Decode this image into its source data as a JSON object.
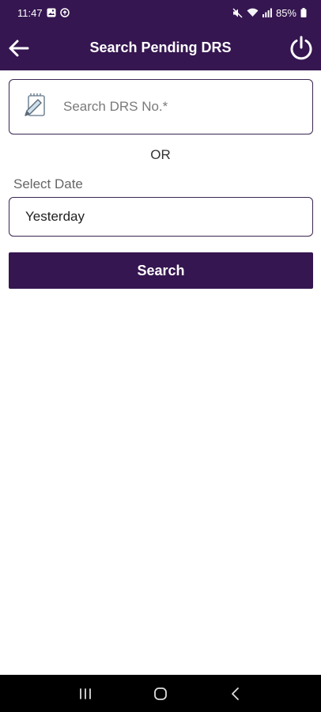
{
  "status_bar": {
    "time": "11:47",
    "battery": "85%"
  },
  "app_bar": {
    "title": "Search Pending DRS",
    "back_icon": "arrow-left-icon",
    "power_icon": "power-icon"
  },
  "search": {
    "placeholder": "Search DRS No.*",
    "value": "",
    "icon": "notepad-pencil-icon"
  },
  "or_label": "OR",
  "date": {
    "label": "Select Date",
    "value": "Yesterday"
  },
  "search_button_label": "Search",
  "nav": {
    "recents_icon": "recents-icon",
    "home_icon": "home-icon",
    "back_icon": "back-chevron-icon"
  },
  "colors": {
    "primary": "#351650",
    "border": "#3a2550",
    "nav_bar": "#000000"
  }
}
